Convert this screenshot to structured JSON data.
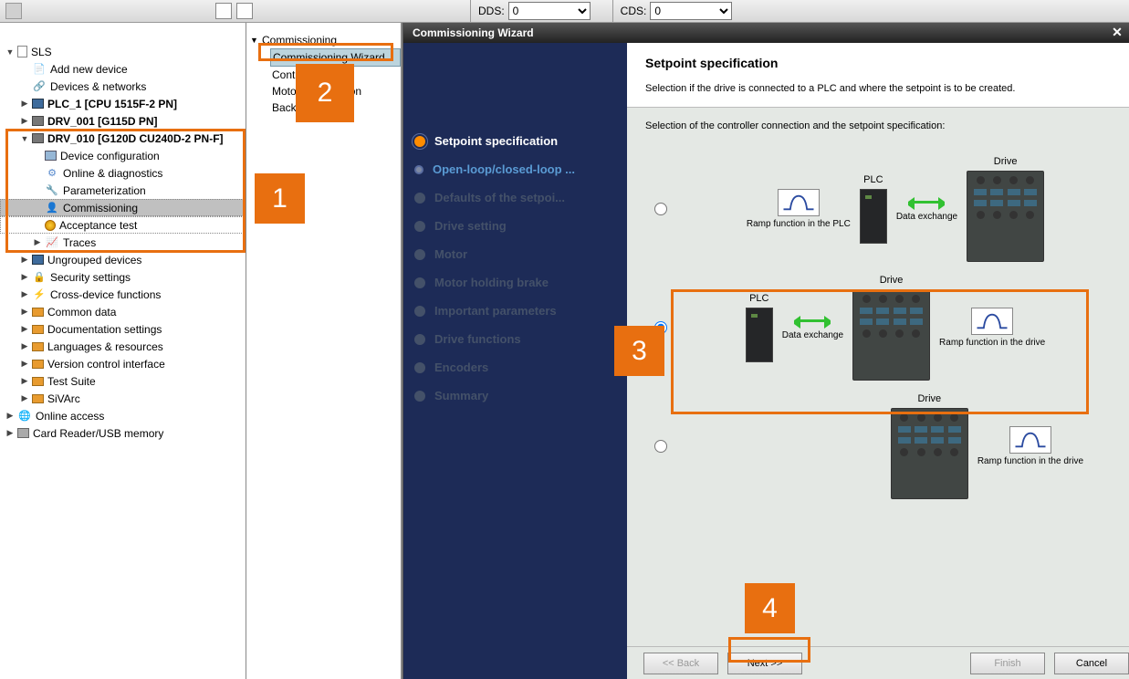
{
  "toolbar": {
    "dds_label": "DDS:",
    "cds_label": "CDS:",
    "dds_value": "0",
    "cds_value": "0"
  },
  "tree": {
    "root": "SLS",
    "add_device": "Add new device",
    "devices_networks": "Devices & networks",
    "plc1": "PLC_1 [CPU 1515F-2 PN]",
    "drv001": "DRV_001 [G115D PN]",
    "drv010": "DRV_010 [G120D CU240D-2 PN-F]",
    "device_config": "Device configuration",
    "online_diag": "Online & diagnostics",
    "param": "Parameterization",
    "commissioning": "Commissioning",
    "accept_test": "Acceptance test",
    "traces": "Traces",
    "ungrouped": "Ungrouped devices",
    "security": "Security settings",
    "crossdev": "Cross-device functions",
    "common": "Common data",
    "docsettings": "Documentation settings",
    "langres": "Languages & resources",
    "vci": "Version control interface",
    "testsuite": "Test Suite",
    "sivarc": "SiVArc",
    "online_access": "Online access",
    "cardreader": "Card Reader/USB memory"
  },
  "middle": {
    "header": "Commissioning",
    "items": {
      "wizard": "Commissioning Wizard",
      "control": "Control panel",
      "motor": "Motor optimization",
      "backup": "Backup/Restore"
    }
  },
  "wizard": {
    "title": "Commissioning Wizard",
    "steps": {
      "setpoint": "Setpoint specification",
      "openloop": "Open-loop/closed-loop ...",
      "defaults": "Defaults of the setpoi...",
      "drive": "Drive setting",
      "motor": "Motor",
      "brake": "Motor holding brake",
      "important": "Important parameters",
      "funcs": "Drive functions",
      "encoders": "Encoders",
      "summary": "Summary"
    },
    "header_title": "Setpoint specification",
    "header_sub": "Selection if the drive is connected to a PLC and where the setpoint is to be created.",
    "main_sub": "Selection of the controller connection and the setpoint specification:",
    "labels": {
      "plc": "PLC",
      "drive": "Drive",
      "ramp_plc": "Ramp function in the PLC",
      "ramp_drive": "Ramp function in the drive",
      "data_exchange": "Data exchange"
    },
    "buttons": {
      "back": "<< Back",
      "next": "Next >>",
      "finish": "Finish",
      "cancel": "Cancel"
    }
  },
  "callouts": {
    "n1": "1",
    "n2": "2",
    "n3": "3",
    "n4": "4"
  }
}
